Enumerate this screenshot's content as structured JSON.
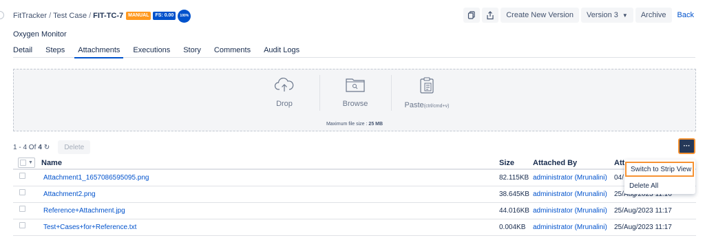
{
  "breadcrumb": {
    "project": "FitTracker",
    "separator": "/",
    "section": "Test Case",
    "key": "FIT-TC-7",
    "badge_type": "MANUAL",
    "badge_fs": "FS: 0.00",
    "badge_progress": "100%"
  },
  "header": {
    "create_version": "Create New Version",
    "version_select": "Version 3",
    "archive": "Archive",
    "back": "Back"
  },
  "page_title": "Oxygen Monitor",
  "tabs": [
    "Detail",
    "Steps",
    "Attachments",
    "Executions",
    "Story",
    "Comments",
    "Audit Logs"
  ],
  "dropzone": {
    "drop": "Drop",
    "browse": "Browse",
    "paste": "Paste",
    "paste_hint": "(ctrl/cmd+v)",
    "max_label": "Maximum file size : ",
    "max_value": "25 MB"
  },
  "toolbar": {
    "range": "1 - 4 Of",
    "total": "4",
    "refresh": "↻",
    "delete": "Delete",
    "more": "···"
  },
  "table": {
    "headers": [
      "Name",
      "Size",
      "Attached By",
      "Att"
    ],
    "rows": [
      {
        "name": "Attachment1_1657086595095.png",
        "size": "82.115KB",
        "by": "administrator (Mrunalini)",
        "at": "04/"
      },
      {
        "name": "Attachment2.png",
        "size": "38.645KB",
        "by": "administrator (Mrunalini)",
        "at": "25/Aug/2023 11:16"
      },
      {
        "name": "Reference+Attachment.jpg",
        "size": "44.016KB",
        "by": "administrator (Mrunalini)",
        "at": "25/Aug/2023 11:17"
      },
      {
        "name": "Test+Cases+for+Reference.txt",
        "size": "0.004KB",
        "by": "administrator (Mrunalini)",
        "at": "25/Aug/2023 11:17"
      }
    ]
  },
  "menu": {
    "strip_view": "Switch to Strip View",
    "delete_all": "Delete All"
  },
  "colors": {
    "link": "#0052cc",
    "manual_badge": "#ff991f",
    "fs_badge": "#0052cc",
    "highlight": "#f79232",
    "more_button": "#253858"
  },
  "icons": {
    "copy": "copy-icon",
    "share": "share-icon",
    "upload": "cloud-upload-icon",
    "folder": "folder-search-icon",
    "paste": "clipboard-icon",
    "refresh": "refresh-icon"
  }
}
